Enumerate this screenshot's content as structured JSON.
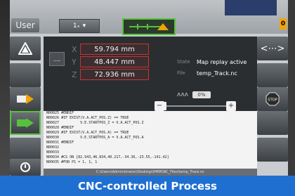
{
  "topbar": {
    "user_label": "User",
    "axis_label": "1ₓ",
    "status_mini_lines": [
      "",
      "",
      ""
    ],
    "badge": "0"
  },
  "coords": [
    {
      "axis": "X",
      "value": "59.794 mm"
    },
    {
      "axis": "Y",
      "value": "48.447 mm"
    },
    {
      "axis": "Z",
      "value": "72.936 mm"
    }
  ],
  "coord_button": "....",
  "info": [
    {
      "key": "State",
      "value": "Map replay active"
    },
    {
      "key": "File",
      "value": "temp_Track.nc"
    }
  ],
  "speed": {
    "percent_label": "0%",
    "minus": "−",
    "plus": "+",
    "level_fraction": 0.0
  },
  "code_lines": [
    "N00025 #ENDIF",
    "N00026 #IF EXIST(V.A.ACT_POS.Z) == TRUE",
    "N00027          V.E.STARTPOS_Z = V.A.ACT_POS.Z",
    "N00028 #ENDIF",
    "N00029 #IF EXIST(V.A.ACT_POS.A) == TRUE",
    "N00030          V.E.STARTPOS_A = V.A.ACT_POS.A",
    "N00031 #ENDIF",
    "N00032",
    "N00033",
    "N00034 #CS ON [82.943,46.834,40.217,-34.36,-23.55,-141.42]",
    "N00035 #FOR P1 = 1, 1, 1"
  ],
  "file_path": "C:\\Users\\Administrator\\Desktop\\HMIR\\NC_Files\\temp_Track.nc",
  "caption": "CNC-controlled Process",
  "colors": {
    "accent": "#1f6fd1",
    "active_green": "#55c23b",
    "coord_border": "#cc3333"
  }
}
